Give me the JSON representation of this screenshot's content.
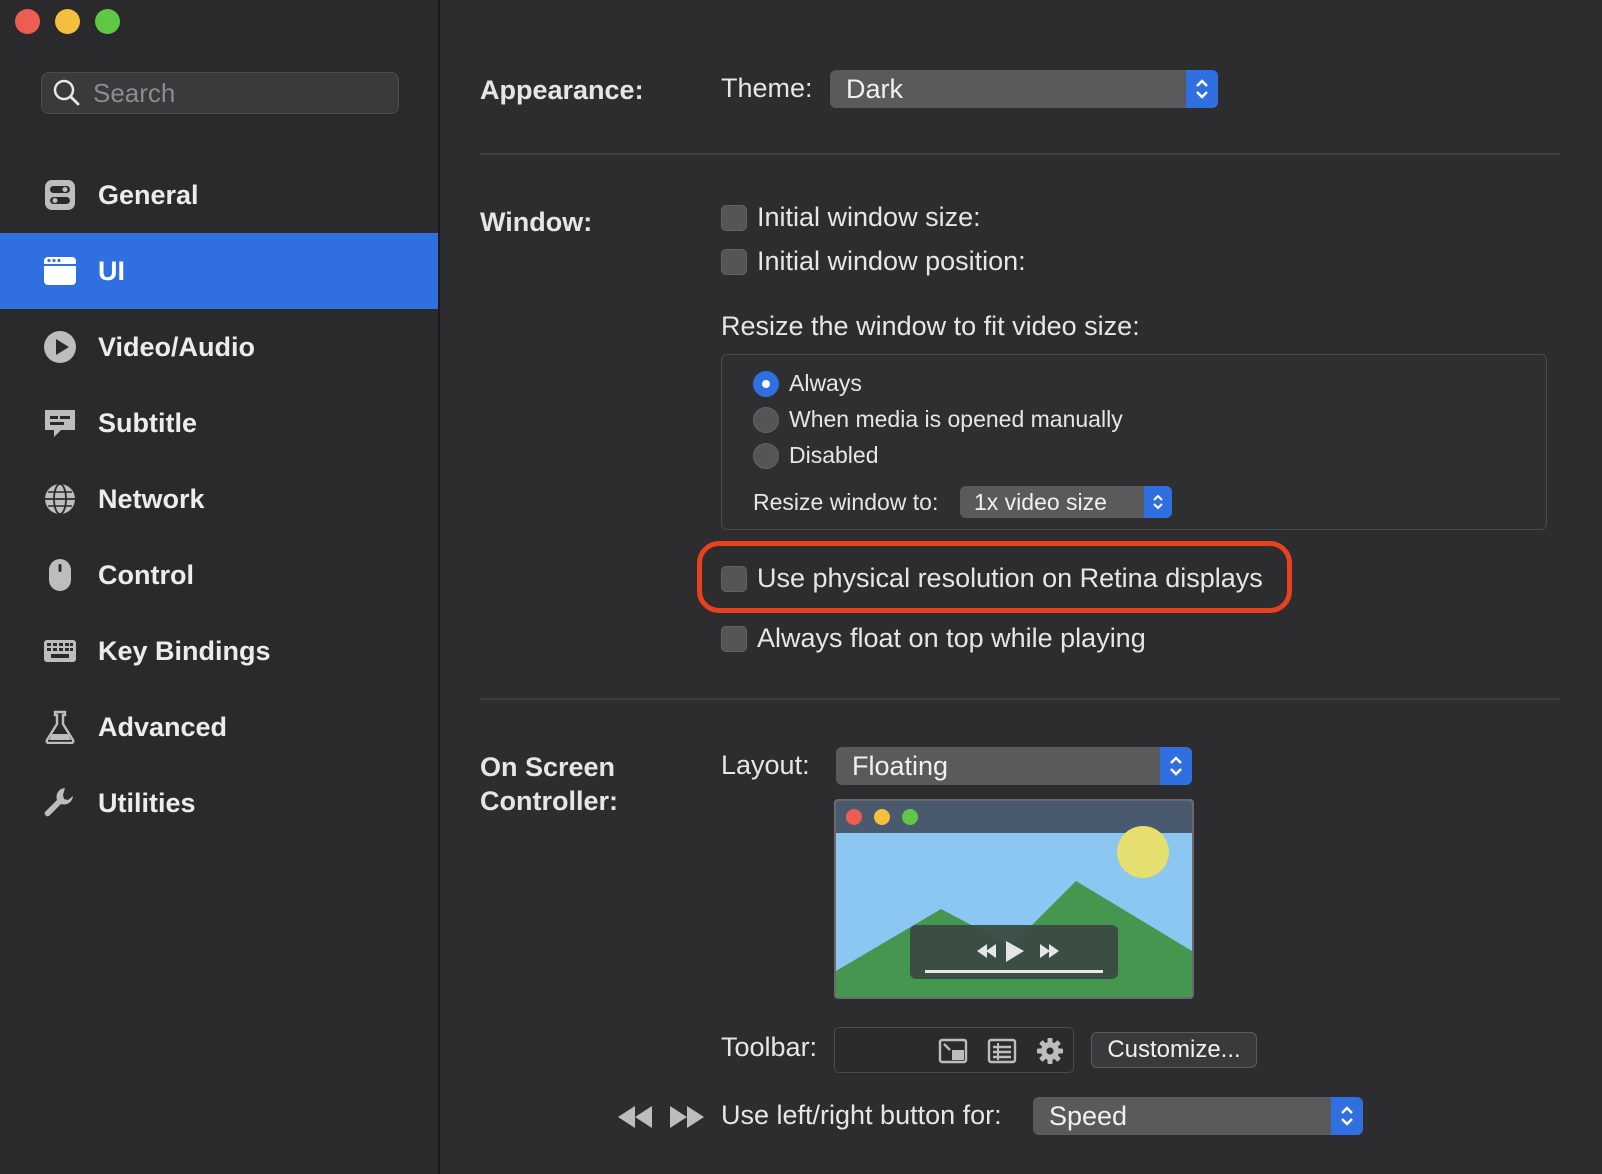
{
  "sidebar": {
    "search_placeholder": "Search",
    "items": [
      {
        "label": "General",
        "icon": "toggles-icon"
      },
      {
        "label": "UI",
        "icon": "window-icon",
        "active": true
      },
      {
        "label": "Video/Audio",
        "icon": "play-icon"
      },
      {
        "label": "Subtitle",
        "icon": "subtitle-icon"
      },
      {
        "label": "Network",
        "icon": "globe-icon"
      },
      {
        "label": "Control",
        "icon": "mouse-icon"
      },
      {
        "label": "Key Bindings",
        "icon": "keyboard-icon"
      },
      {
        "label": "Advanced",
        "icon": "flask-icon"
      },
      {
        "label": "Utilities",
        "icon": "wrench-icon"
      }
    ]
  },
  "appearance": {
    "section_label": "Appearance:",
    "theme_label": "Theme:",
    "theme_value": "Dark"
  },
  "window": {
    "section_label": "Window:",
    "initial_size_label": "Initial window size:",
    "initial_position_label": "Initial window position:",
    "resize_heading": "Resize the window to fit video size:",
    "radio_always": "Always",
    "radio_manual": "When media is opened manually",
    "radio_disabled": "Disabled",
    "resize_to_label": "Resize window to:",
    "resize_to_value": "1x video size",
    "retina_label": "Use physical resolution on Retina displays",
    "float_label": "Always float on top while playing"
  },
  "osc": {
    "section_label_line1": "On Screen",
    "section_label_line2": "Controller:",
    "layout_label": "Layout:",
    "layout_value": "Floating",
    "toolbar_label": "Toolbar:",
    "customize_button": "Customize...",
    "leftright_label": "Use left/right button for:",
    "leftright_value": "Speed"
  },
  "colors": {
    "accent": "#2f6fdf",
    "highlight": "#e8411d",
    "background": "#2d2d2f"
  }
}
